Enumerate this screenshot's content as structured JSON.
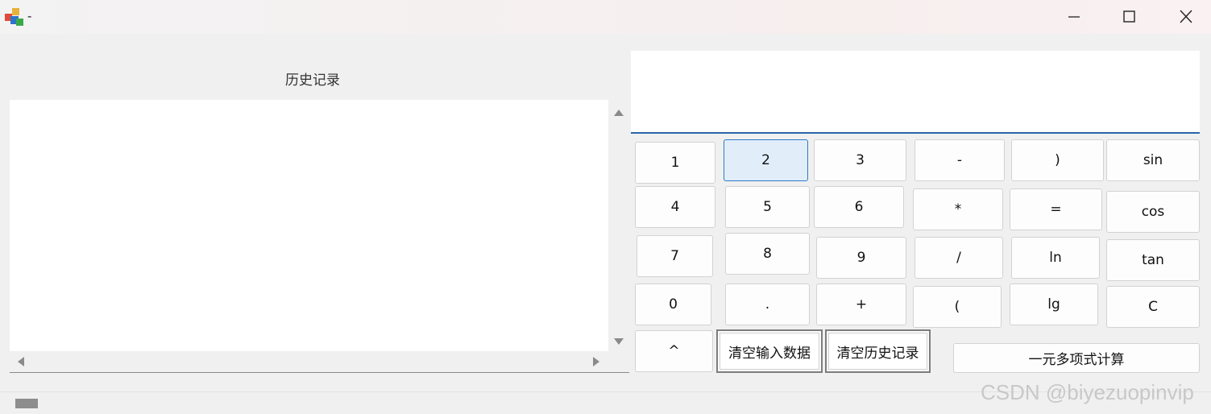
{
  "window": {
    "title": "-",
    "controls": {
      "minimize": "minimize-icon",
      "maximize": "maximize-icon",
      "close": "close-icon"
    }
  },
  "history": {
    "title": "历史记录",
    "items": []
  },
  "display": {
    "value": ""
  },
  "keys": {
    "k1": "1",
    "k2": "2",
    "k3": "3",
    "minus": "-",
    "rparen": ")",
    "sin": "sin",
    "k4": "4",
    "k5": "5",
    "k6": "6",
    "mul": "*",
    "eq": "=",
    "cos": "cos",
    "k7": "7",
    "k8": "8",
    "k9": "9",
    "div": "/",
    "ln": "ln",
    "tan": "tan",
    "k0": "0",
    "dot": ".",
    "plus": "+",
    "lparen": "(",
    "lg": "lg",
    "clear": "C",
    "pow": "^",
    "clear_input": "清空输入数据",
    "clear_history": "清空历史记录",
    "polynomial": "一元多项式计算"
  },
  "watermark": "CSDN @biyezuopinvip",
  "colors": {
    "accent": "#2d79c7",
    "display_border": "#2a66a8",
    "active_key_bg": "#e1eefa"
  }
}
